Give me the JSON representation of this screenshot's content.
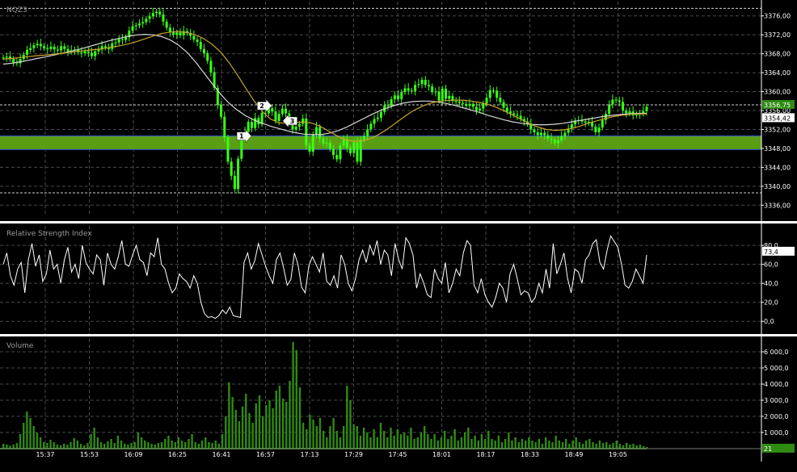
{
  "colors": {
    "background": "#000000",
    "grid": "#4a4a4a",
    "candle": "#39ff14",
    "ma_slow": "#d8d8d8",
    "ma_fast": "#c9a52a",
    "support_band": "#5a9e14",
    "support_edge": "#2d4fd6",
    "rsi_line": "#ffffff",
    "volume_bar": "#2f8a12",
    "separator": "#ffffff"
  },
  "chart_data": [
    {
      "type": "line",
      "title": "NQZ3",
      "ylim": [
        3334,
        3378
      ],
      "y_ticks": [
        "3376,00",
        "3372,00",
        "3368,00",
        "3364,00",
        "3360,00",
        "3356,00",
        "3352,00",
        "3348,00",
        "3344,00",
        "3340,00",
        "3336,00"
      ],
      "y_tick_values": [
        3376,
        3372,
        3368,
        3364,
        3360,
        3356,
        3352,
        3348,
        3344,
        3340,
        3336
      ],
      "x_ticks": [
        "15:37",
        "15:53",
        "16:09",
        "16:25",
        "16:41",
        "16:57",
        "17:13",
        "17:29",
        "17:45",
        "18:01",
        "18:17",
        "18:33",
        "18:49",
        "19:05"
      ],
      "current_price_label": "3356,75",
      "secondary_price_label": "3354,42",
      "support_band": [
        3348.1,
        3350.3
      ],
      "dashed_levels": [
        3377.6,
        3357.2,
        3338.6
      ],
      "close_series": [
        3367.2,
        3367.4,
        3366.9,
        3366.2,
        3366.0,
        3366.9,
        3367.8,
        3368.8,
        3369.2,
        3369.8,
        3370.1,
        3369.6,
        3369.2,
        3369.0,
        3369.5,
        3368.9,
        3368.7,
        3369.6,
        3369.0,
        3368.4,
        3368.7,
        3368.9,
        3368.3,
        3368.1,
        3368.5,
        3368.2,
        3367.5,
        3368.5,
        3368.9,
        3369.6,
        3369.3,
        3369.0,
        3370.2,
        3370.4,
        3371.1,
        3370.9,
        3371.5,
        3372.9,
        3373.8,
        3374.0,
        3374.4,
        3374.7,
        3375.4,
        3375.9,
        3376.6,
        3376.9,
        3376.3,
        3374.8,
        3373.5,
        3372.5,
        3372.0,
        3372.5,
        3371.9,
        3372.8,
        3372.4,
        3371.8,
        3371.0,
        3370.5,
        3369.0,
        3368.1,
        3366.5,
        3364.1,
        3360.8,
        3357.2,
        3354.7,
        3350.3,
        3345.2,
        3342.2,
        3339.4,
        3345.8,
        3350.3,
        3351.5,
        3353.6,
        3352.3,
        3354.4,
        3353.1,
        3355.5,
        3355.4,
        3356.5,
        3355.8,
        3353.8,
        3355.3,
        3356.4,
        3355.4,
        3353.4,
        3352.0,
        3352.6,
        3353.2,
        3354.3,
        3348.6,
        3347.3,
        3350.8,
        3352.5,
        3350.1,
        3349.0,
        3349.2,
        3347.9,
        3346.6,
        3345.7,
        3348.6,
        3349.9,
        3348.1,
        3347.0,
        3349.3,
        3345.2,
        3349.9,
        3350.6,
        3352.0,
        3353.2,
        3354.2,
        3354.5,
        3355.7,
        3357.1,
        3357.0,
        3358.4,
        3359.2,
        3358.4,
        3359.9,
        3360.7,
        3360.2,
        3360.1,
        3361.4,
        3361.6,
        3362.5,
        3361.4,
        3361.1,
        3359.9,
        3360.0,
        3358.1,
        3360.6,
        3358.5,
        3359.1,
        3358.0,
        3357.9,
        3357.6,
        3357.4,
        3357.0,
        3357.4,
        3356.8,
        3356.0,
        3356.4,
        3357.5,
        3358.7,
        3360.3,
        3360.2,
        3358.7,
        3357.8,
        3356.6,
        3355.8,
        3355.4,
        3355.1,
        3354.9,
        3354.2,
        3353.7,
        3353.2,
        3352.0,
        3351.4,
        3350.8,
        3351.3,
        3350.8,
        3350.1,
        3349.8,
        3349.1,
        3349.7,
        3350.6,
        3351.3,
        3352.2,
        3353.1,
        3353.9,
        3354.0,
        3353.7,
        3353.4,
        3353.6,
        3352.6,
        3351.4,
        3352.4,
        3354.0,
        3355.3,
        3357.3,
        3358.3,
        3358.1,
        3357.8,
        3356.0,
        3355.4,
        3355.8,
        3355.0,
        3355.2,
        3355.3,
        3355.9,
        3356.8
      ],
      "ma_fast_series": [
        3366.9,
        3367.0,
        3367.2,
        3367.4,
        3367.6,
        3367.7,
        3367.9,
        3368.1,
        3368.3,
        3368.5,
        3368.7,
        3368.9,
        3369.1,
        3369.4,
        3369.7,
        3370.1,
        3370.6,
        3371.2,
        3371.8,
        3372.3,
        3372.6,
        3372.7,
        3372.5,
        3372.0,
        3371.2,
        3370.0,
        3368.4,
        3366.2,
        3363.6,
        3360.8,
        3358.1,
        3355.8,
        3354.2,
        3353.4,
        3353.3,
        3353.5,
        3353.6,
        3353.3,
        3352.6,
        3351.6,
        3350.6,
        3349.8,
        3349.5,
        3349.6,
        3350.1,
        3351.0,
        3352.1,
        3353.4,
        3354.7,
        3355.9,
        3356.8,
        3357.5,
        3357.9,
        3358.1,
        3358.2,
        3358.2,
        3358.0,
        3357.7,
        3357.3,
        3356.7,
        3355.9,
        3355.0,
        3354.1,
        3353.2,
        3352.5,
        3352.0,
        3351.8,
        3351.9,
        3352.2,
        3352.7,
        3353.3,
        3353.8,
        3354.3,
        3354.7,
        3355.0,
        3355.2,
        3355.3,
        3355.3
      ],
      "ma_slow_series": [
        3365.8,
        3366.0,
        3366.3,
        3366.6,
        3367.0,
        3367.3,
        3367.7,
        3368.1,
        3368.5,
        3368.9,
        3369.4,
        3369.9,
        3370.4,
        3370.9,
        3371.3,
        3371.7,
        3372.0,
        3372.1,
        3372.0,
        3371.6,
        3370.9,
        3369.8,
        3368.3,
        3366.3,
        3364.0,
        3361.7,
        3359.5,
        3357.6,
        3356.1,
        3354.9,
        3354.0,
        3353.3,
        3352.7,
        3352.2,
        3351.7,
        3351.3,
        3351.0,
        3350.9,
        3350.9,
        3351.2,
        3351.7,
        3352.4,
        3353.3,
        3354.2,
        3355.1,
        3355.9,
        3356.6,
        3357.2,
        3357.6,
        3357.9,
        3358.0,
        3358.0,
        3357.8,
        3357.5,
        3357.1,
        3356.6,
        3356.1,
        3355.6,
        3355.0,
        3354.5,
        3354.0,
        3353.6,
        3353.3,
        3353.1,
        3353.0,
        3353.0,
        3353.1,
        3353.3,
        3353.6,
        3353.9,
        3354.2,
        3354.5,
        3354.8,
        3355.0,
        3355.2,
        3355.3,
        3355.4,
        3355.4
      ],
      "markers": [
        {
          "label": "1",
          "x_index": 71,
          "price": 3350.6,
          "direction": "right"
        },
        {
          "label": "2",
          "x_index": 77,
          "price": 3357.0,
          "direction": "right"
        },
        {
          "label": "3",
          "x_index": 84,
          "price": 3353.8,
          "direction": "left"
        }
      ]
    },
    {
      "type": "line",
      "title": "Relative Strength Index",
      "ylim": [
        -10,
        92
      ],
      "y_ticks": [
        "80,0",
        "60,0",
        "40,0",
        "20,0",
        "0,0"
      ],
      "y_tick_values": [
        80,
        60,
        40,
        20,
        0
      ],
      "current_value_label": "73,4",
      "values": [
        60,
        72,
        48,
        38,
        55,
        62,
        30,
        65,
        82,
        58,
        70,
        42,
        50,
        75,
        55,
        60,
        40,
        65,
        78,
        52,
        60,
        45,
        80,
        62,
        55,
        50,
        70,
        65,
        38,
        72,
        60,
        55,
        68,
        85,
        60,
        58,
        70,
        80,
        65,
        62,
        48,
        72,
        68,
        88,
        60,
        55,
        40,
        30,
        35,
        50,
        45,
        42,
        35,
        48,
        40,
        20,
        8,
        4,
        5,
        3,
        6,
        12,
        8,
        15,
        6,
        5,
        4,
        62,
        72,
        55,
        64,
        82,
        70,
        58,
        48,
        40,
        65,
        72,
        56,
        38,
        44,
        72,
        60,
        36,
        30,
        58,
        68,
        60,
        52,
        72,
        42,
        38,
        48,
        35,
        70,
        60,
        40,
        32,
        45,
        65,
        75,
        62,
        80,
        70,
        85,
        60,
        75,
        70,
        48,
        82,
        65,
        55,
        88,
        82,
        70,
        35,
        50,
        40,
        28,
        25,
        55,
        45,
        40,
        62,
        30,
        40,
        55,
        48,
        72,
        85,
        80,
        38,
        30,
        45,
        28,
        20,
        15,
        25,
        40,
        35,
        20,
        50,
        60,
        45,
        28,
        32,
        30,
        20,
        25,
        40,
        30,
        55,
        35,
        82,
        50,
        60,
        72,
        45,
        30,
        55,
        52,
        40,
        65,
        70,
        82,
        86,
        62,
        55,
        75,
        90,
        84,
        78,
        60,
        38,
        35,
        42,
        55,
        48,
        40,
        70
      ],
      "last_value": 73.4
    },
    {
      "type": "bar",
      "title": "Volume",
      "ylim": [
        0,
        6800
      ],
      "y_ticks": [
        "6 000,0",
        "5 000,0",
        "4 000,0",
        "3 000,0",
        "2 000,0",
        "1 000,0"
      ],
      "y_tick_values": [
        6000,
        5000,
        4000,
        3000,
        2000,
        1000
      ],
      "current_value_label": "21",
      "values": [
        300,
        250,
        180,
        260,
        350,
        900,
        1600,
        2300,
        1900,
        1400,
        1000,
        700,
        400,
        350,
        550,
        400,
        250,
        200,
        300,
        250,
        400,
        650,
        500,
        300,
        200,
        350,
        900,
        1300,
        700,
        400,
        300,
        450,
        600,
        350,
        800,
        500,
        300,
        250,
        350,
        400,
        1000,
        700,
        500,
        400,
        300,
        250,
        350,
        400,
        600,
        800,
        500,
        400,
        700,
        500,
        400,
        600,
        900,
        400,
        300,
        500,
        700,
        400,
        350,
        500,
        300,
        900,
        2000,
        4100,
        3200,
        2400,
        1700,
        2600,
        3400,
        2200,
        1600,
        2800,
        3300,
        2000,
        2700,
        3000,
        2500,
        3600,
        3900,
        3100,
        2900,
        4200,
        6600,
        6100,
        3800,
        1600,
        1200,
        2100,
        1800,
        1400,
        1900,
        1100,
        700,
        1400,
        1900,
        1100,
        700,
        1400,
        3900,
        3000,
        1500,
        1400,
        800,
        1300,
        1000,
        700,
        1200,
        700,
        1600,
        1100,
        700,
        1300,
        800,
        1200,
        900,
        1000,
        800,
        1300,
        600,
        700,
        1000,
        1400,
        900,
        600,
        900,
        500,
        700,
        1100,
        600,
        800,
        1200,
        500,
        700,
        1000,
        1300,
        600,
        800,
        500,
        900,
        600,
        1100,
        600,
        500,
        800,
        400,
        600,
        1000,
        500,
        700,
        400,
        600,
        500,
        700,
        500,
        400,
        600,
        300,
        700,
        500,
        400,
        800,
        500,
        400,
        600,
        300,
        500,
        700,
        400,
        300,
        500,
        600,
        400,
        300,
        500,
        350,
        400,
        250,
        350,
        500,
        300,
        200,
        350,
        250,
        300,
        200,
        250,
        150,
        100
      ]
    }
  ]
}
